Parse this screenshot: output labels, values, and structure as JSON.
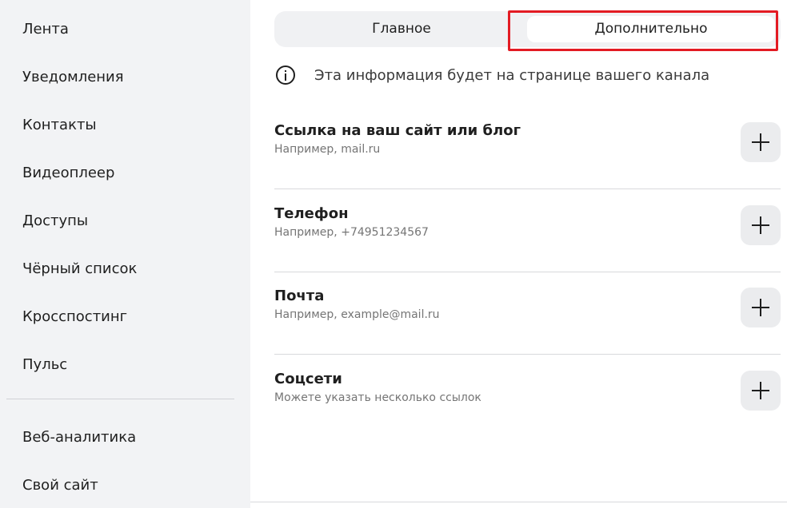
{
  "sidebar": {
    "items": [
      {
        "label": "Лента"
      },
      {
        "label": "Уведомления"
      },
      {
        "label": "Контакты"
      },
      {
        "label": "Видеоплеер"
      },
      {
        "label": "Доступы"
      },
      {
        "label": "Чёрный список"
      },
      {
        "label": "Кросспостинг"
      },
      {
        "label": "Пульс"
      },
      {
        "label": "Веб-аналитика"
      },
      {
        "label": "Свой сайт"
      }
    ]
  },
  "tabs": {
    "main": "Главное",
    "extra": "Дополнительно"
  },
  "highlight_color": "#e31b23",
  "info": {
    "icon": "info-icon",
    "text": "Эта информация будет на странице вашего канала"
  },
  "sections": [
    {
      "title": "Ссылка на ваш сайт или блог",
      "hint": "Например, mail.ru",
      "icon": "plus-icon"
    },
    {
      "title": "Телефон",
      "hint": "Например, +74951234567",
      "icon": "plus-icon"
    },
    {
      "title": "Почта",
      "hint": "Например, example@mail.ru",
      "icon": "plus-icon"
    },
    {
      "title": "Соцсети",
      "hint": "Можете указать несколько ссылок",
      "icon": "plus-icon"
    }
  ]
}
